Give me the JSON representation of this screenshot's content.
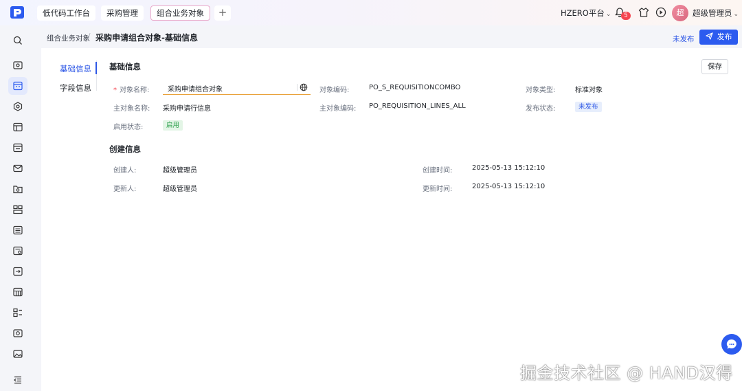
{
  "header": {
    "tabs": [
      {
        "label": "低代码工作台"
      },
      {
        "label": "采购管理"
      },
      {
        "label": "组合业务对象"
      }
    ],
    "add_tab_symbol": "+",
    "platform": "HZERO平台",
    "notification_count": "5",
    "avatar_text": "超",
    "username": "超级管理员",
    "caret": "⌄"
  },
  "breadcrumb": {
    "parent": "组合业务对象",
    "separator": "/",
    "title": "采购申请组合对象-基础信息"
  },
  "actions": {
    "status_link": "未发布",
    "publish_label": "发布",
    "save_label": "保存"
  },
  "side_nav": {
    "items": [
      {
        "label": "基础信息"
      },
      {
        "label": "字段信息"
      }
    ]
  },
  "basic_info": {
    "section_title": "基础信息",
    "object_name_label": "对象名称:",
    "object_name_value": "采购申请组合对象",
    "object_code_label": "对象编码:",
    "object_code_value": "PO_S_REQUISITIONCOMBO",
    "object_type_label": "对象类型:",
    "object_type_value": "标准对象",
    "main_object_name_label": "主对象名称:",
    "main_object_name_value": "采购申请行信息",
    "main_object_code_label": "主对象编码:",
    "main_object_code_value": "PO_REQUISITION_LINES_ALL",
    "publish_status_label": "发布状态:",
    "publish_status_value": "未发布",
    "enable_status_label": "启用状态:",
    "enable_status_value": "启用"
  },
  "create_info": {
    "section_title": "创建信息",
    "creator_label": "创建人:",
    "creator_value": "超级管理员",
    "create_time_label": "创建时间:",
    "create_time_value": "2025-05-13 15:12:10",
    "updater_label": "更新人:",
    "updater_value": "超级管理员",
    "update_time_label": "更新时间:",
    "update_time_value": "2025-05-13 15:12:10"
  },
  "icons": {
    "logo": "app-logo",
    "bell": "bell-icon",
    "shirt": "theme-icon",
    "play": "play-icon",
    "globe": "globe-icon",
    "send": "send-icon",
    "chat": "chat-icon"
  },
  "colors": {
    "primary": "#2c5bef",
    "danger": "#f5454f",
    "success": "#2ca04a",
    "input_focus": "#e9a23b"
  },
  "watermark": "掘金技术社区 @ HAND汉得"
}
